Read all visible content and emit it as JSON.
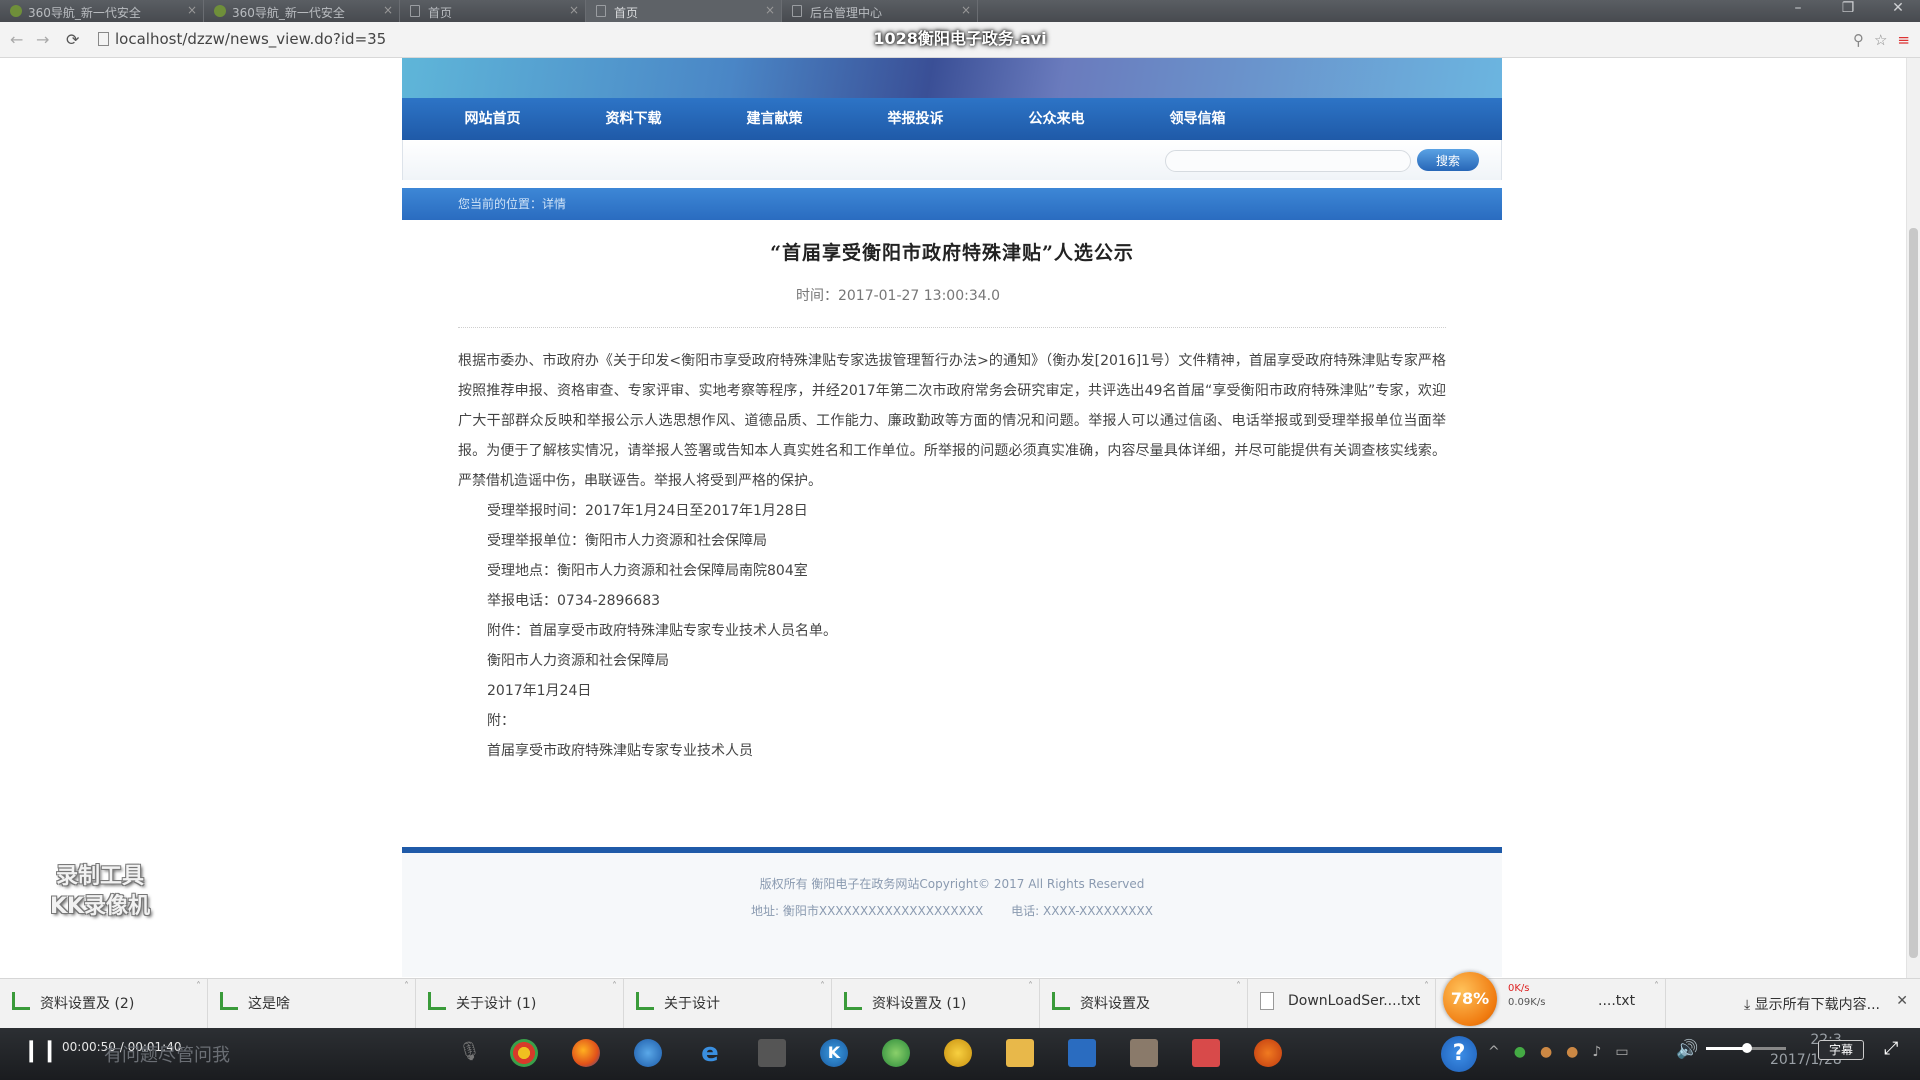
{
  "browser": {
    "tabs": [
      {
        "label": "360导航_新一代安全"
      },
      {
        "label": "360导航_新一代安全"
      },
      {
        "label": "首页"
      },
      {
        "label": "首页"
      },
      {
        "label": "后台管理中心"
      }
    ],
    "url": "localhost/dzzw/news_view.do?id=35",
    "video_title": "1028衡阳电子政务.avi"
  },
  "site": {
    "nav": [
      "网站首页",
      "资料下载",
      "建言献策",
      "举报投诉",
      "公众来电",
      "领导信箱"
    ],
    "search_button": "搜索",
    "search_placeholder": "",
    "breadcrumb": "您当前的位置：详情"
  },
  "article": {
    "title": "“首届享受衡阳市政府特殊津贴”人选公示",
    "time": "时间：2017-01-27 13:00:34.0",
    "paragraph": "根据市委办、市政府办《关于印发<衡阳市享受政府特殊津贴专家选拔管理暂行办法>的通知》（衡办发[2016]1号）文件精神，首届享受政府特殊津贴专家严格按照推荐申报、资格审查、专家评审、实地考察等程序，并经2017年第二次市政府常务会研究审定，共评选出49名首届“享受衡阳市政府特殊津贴”专家，欢迎广大干部群众反映和举报公示人选思想作风、道德品质、工作能力、廉政勤政等方面的情况和问题。举报人可以通过信函、电话举报或到受理举报单位当面举报。为便于了解核实情况，请举报人签署或告知本人真实姓名和工作单位。所举报的问题必须真实准确，内容尽量具体详细，并尽可能提供有关调查核实线索。严禁借机造谣中伤，串联诬告。举报人将受到严格的保护。",
    "lines": [
      "受理举报时间：2017年1月24日至2017年1月28日",
      "受理举报单位：衡阳市人力资源和社会保障局",
      "受理地点：衡阳市人力资源和社会保障局南院804室",
      "举报电话：0734-2896683",
      "附件：首届享受市政府特殊津贴专家专业技术人员名单。",
      "衡阳市人力资源和社会保障局",
      "2017年1月24日",
      "附：",
      "首届享受市政府特殊津贴专家专业技术人员"
    ]
  },
  "footer": {
    "copyright": "版权所有 衡阳电子在政务网站Copyright© 2017 All Rights Reserved",
    "address": "地址: 衡阳市XXXXXXXXXXXXXXXXXXXX",
    "phone": "电话: XXXX-XXXXXXXXX"
  },
  "watermark": {
    "line1": "录制工具",
    "line2": "KK录像机"
  },
  "downloads": {
    "items": [
      "资料设置及 (2)",
      "这是啥",
      "关于设计 (1)",
      "关于设计",
      "资料设置及 (1)",
      "资料设置及",
      "DownLoadSer....txt",
      "....txt"
    ],
    "show_all": "显示所有下载内容...",
    "speed_percent": "78%",
    "speed_up": "0K/s",
    "speed_down": "0.09K/s"
  },
  "taskbar": {
    "player_time": "00:00:50 / 00:01:40",
    "search_hint": "有问题尽管问我",
    "clock_time": "22:3",
    "clock_date": "2017/1/28",
    "subtitle_label": "字幕"
  }
}
